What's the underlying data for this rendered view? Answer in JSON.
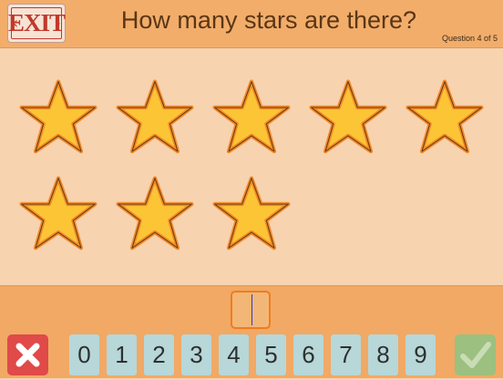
{
  "header": {
    "exit_label": "EXIT",
    "title": "How many stars are there?",
    "question_counter": "Question 4 of 5"
  },
  "stars": {
    "count": 8,
    "row1": 5,
    "row2": 3,
    "color": "#fcc535",
    "outline": "#f08a2a"
  },
  "answer": {
    "value": ""
  },
  "keypad": {
    "digits": [
      "0",
      "1",
      "2",
      "3",
      "4",
      "5",
      "6",
      "7",
      "8",
      "9"
    ],
    "clear_icon": "x-icon",
    "submit_icon": "checkmark-icon"
  },
  "colors": {
    "header_bg": "#f2ad6b",
    "board_bg": "#f7d3b0",
    "exit_red": "#c0392b",
    "clear_red": "#e04a48",
    "submit_green": "#9cc07f",
    "digit_key": "#b7d7d9"
  }
}
